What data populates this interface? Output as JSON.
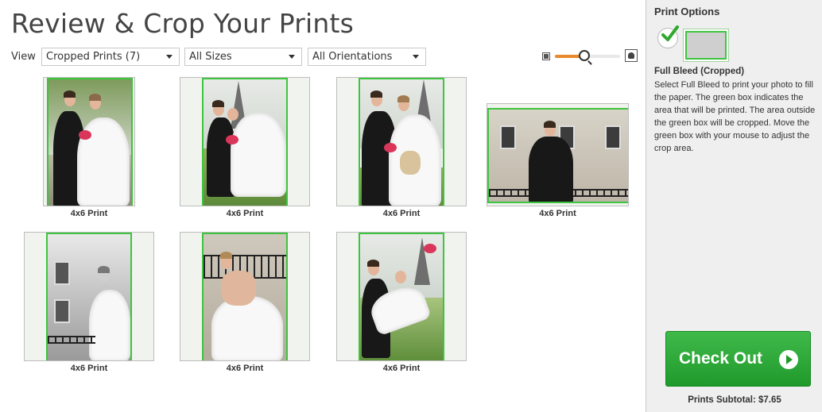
{
  "page": {
    "title": "Review & Crop Your Prints"
  },
  "filters": {
    "view_label": "View",
    "view_selected": "Cropped Prints (7)",
    "size_selected": "All Sizes",
    "orientation_selected": "All Orientations"
  },
  "zoom": {
    "level": 0.45
  },
  "prints": [
    {
      "label": "4x6 Print"
    },
    {
      "label": "4x6 Print"
    },
    {
      "label": "4x6 Print"
    },
    {
      "label": "4x6 Print"
    },
    {
      "label": "4x6 Print"
    },
    {
      "label": "4x6 Print"
    },
    {
      "label": "4x6 Print"
    }
  ],
  "sidebar": {
    "title": "Print Options",
    "option_name": "Full Bleed (Cropped)",
    "description": "Select Full Bleed to print your photo to fill the paper. The green box indicates the area that will be printed. The area outside the green box will be cropped. Move the green box with your mouse to adjust the crop area.",
    "checkout_label": "Check Out",
    "subtotal": "Prints Subtotal: $7.65"
  },
  "colors": {
    "crop_border": "#3ec43e",
    "checkout_green": "#2aa836",
    "zoom_fill": "#e8892b"
  },
  "icons": [
    "checkmark-icon",
    "small-image-icon",
    "large-image-icon",
    "arrow-right-circle-icon",
    "dropdown-caret-icon"
  ]
}
